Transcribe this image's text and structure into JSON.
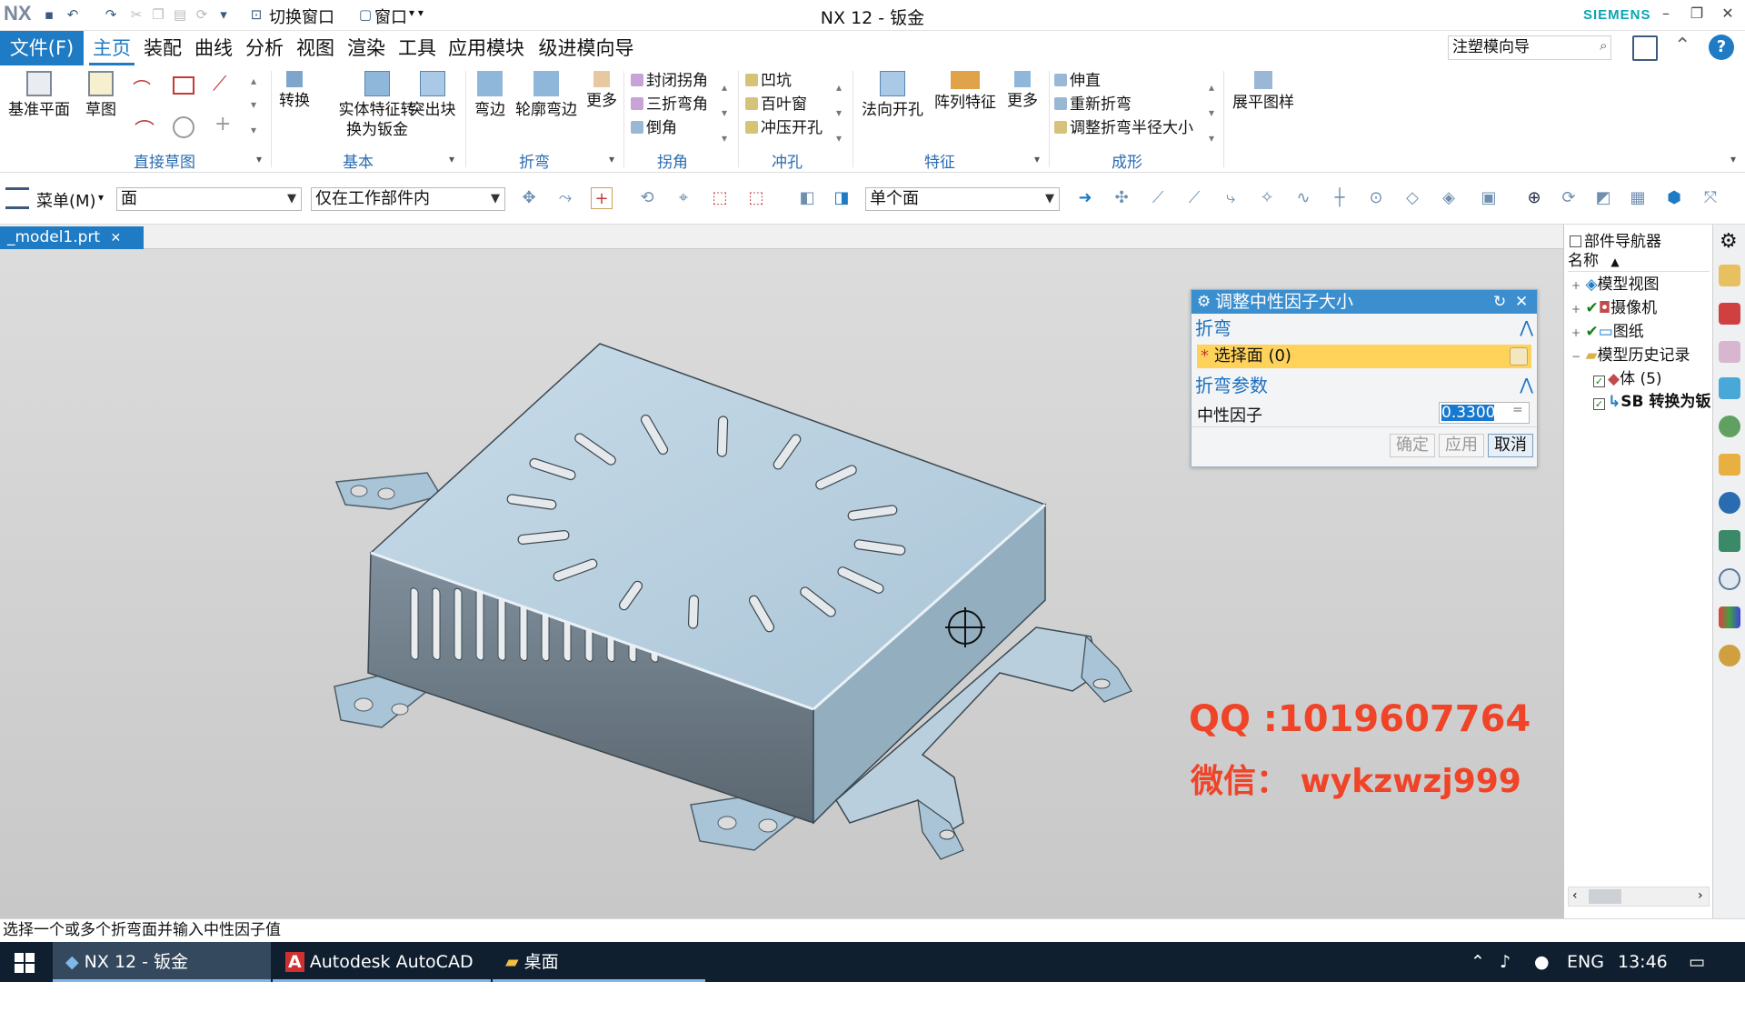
{
  "window": {
    "logo": "NX",
    "title": "NX 12 - 钣金",
    "brand": "SIEMENS",
    "quick_access": {
      "switch_window": "切换窗口",
      "window": "窗口"
    }
  },
  "menubar": {
    "file": "文件(F)",
    "items": [
      "主页",
      "装配",
      "曲线",
      "分析",
      "视图",
      "渲染",
      "工具",
      "应用模块",
      "级进模向导"
    ],
    "search_value": "注塑模向导"
  },
  "ribbon": {
    "datum_plane": "基准平面",
    "sketch": "草图",
    "direct_sketch_group": "直接草图",
    "convert": "转换",
    "solid_to_sheet_line1": "实体特征转",
    "solid_to_sheet_line2": "换为钣金",
    "tab": "突出块",
    "basic_group": "基本",
    "flange": "弯边",
    "contour_flange": "轮廓弯边",
    "more_bend": "更多",
    "bend_group": "折弯",
    "corner_items": [
      "封闭拐角",
      "三折弯角",
      "倒角"
    ],
    "corner_group": "拐角",
    "punch_items": [
      "凹坑",
      "百叶窗",
      "冲压开孔"
    ],
    "punch_group": "冲孔",
    "normal_cutout": "法向开孔",
    "pattern_feature": "阵列特征",
    "more_feature": "更多",
    "feature_group": "特征",
    "form_items": [
      "伸直",
      "重新折弯",
      "调整折弯半径大小"
    ],
    "form_group": "成形",
    "flat_pattern": "展平图样"
  },
  "selection_bar": {
    "menu": "菜单(M)",
    "filter": "面",
    "scope": "仅在工作部件内",
    "face_rule": "单个面"
  },
  "doc_tab": "_model1.prt",
  "dialog": {
    "title": "调整中性因子大小",
    "section_bend": "折弯",
    "select_face": "选择面 (0)",
    "section_params": "折弯参数",
    "neutral_factor_label": "中性因子",
    "neutral_factor_value": "0.3300",
    "ok": "确定",
    "apply": "应用",
    "cancel": "取消"
  },
  "navigator": {
    "title": "部件导航器",
    "column": "名称",
    "items": [
      {
        "label": "模型视图"
      },
      {
        "label": "摄像机"
      },
      {
        "label": "图纸"
      },
      {
        "label": "模型历史记录"
      },
      {
        "label": "体 (5)"
      },
      {
        "label": "SB 转换为钣"
      }
    ]
  },
  "watermark": {
    "qq": "QQ :1019607764",
    "wechat": "微信：  wykzwzj999"
  },
  "status_text": "选择一个或多个折弯面并输入中性因子值",
  "taskbar": {
    "tasks": [
      "NX 12 - 钣金",
      "Autodesk AutoCAD ...",
      "桌面"
    ],
    "lang": "ENG",
    "time": "13:46"
  }
}
